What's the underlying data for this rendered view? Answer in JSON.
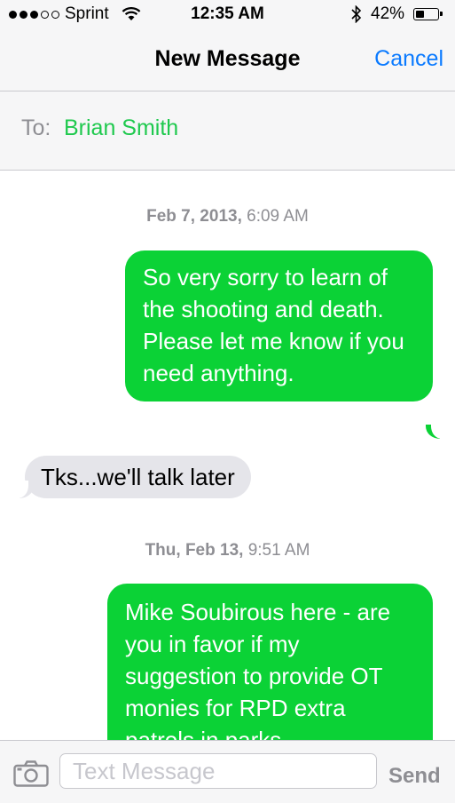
{
  "status_bar": {
    "carrier": "Sprint",
    "time": "12:35 AM",
    "battery_percent": "42%",
    "battery_level": 0.42,
    "signal_bars": 3,
    "signal_max": 5
  },
  "nav": {
    "title": "New Message",
    "cancel_label": "Cancel"
  },
  "to_field": {
    "label": "To:",
    "recipient": "Brian Smith"
  },
  "conversation": [
    {
      "timestamp_day": "Feb 7, 2013,",
      "timestamp_time": " 6:09 AM"
    },
    {
      "direction": "outgoing",
      "text": "So very sorry to learn of the shooting and death. Please let me know if you need anything."
    },
    {
      "direction": "incoming",
      "text": "Tks...we'll talk later"
    },
    {
      "timestamp_day": "Thu, Feb 13,",
      "timestamp_time": " 9:51 AM"
    },
    {
      "direction": "outgoing",
      "text": "Mike  Soubirous here - are you in favor if my suggestion to provide OT monies for RPD extra patrols in parks"
    }
  ],
  "input": {
    "placeholder": "Text Message",
    "send_label": "Send"
  },
  "colors": {
    "accent_blue": "#0a7aff",
    "imessage_green": "#0bd236",
    "incoming_gray": "#e5e5ea"
  }
}
